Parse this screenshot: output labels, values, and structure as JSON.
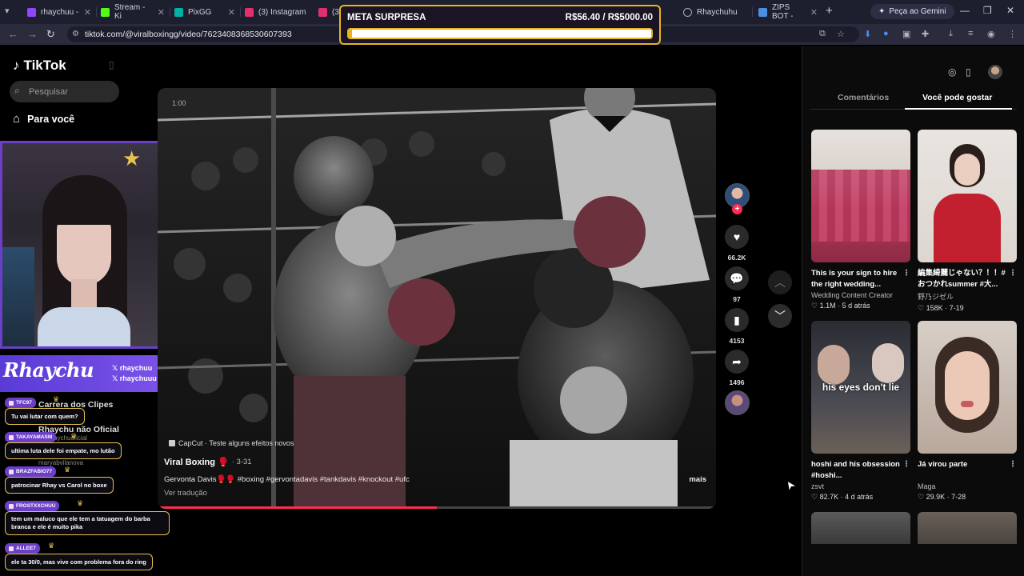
{
  "browser": {
    "tabs": [
      {
        "label": "rhaychuu - ",
        "fav_color": "#9147ff",
        "active": false
      },
      {
        "label": "Stream - Ki",
        "fav_color": "#53fc18",
        "active": false
      },
      {
        "label": "PixGG",
        "fav_color": "#00b3a6",
        "active": false
      },
      {
        "label": "(3) Instagram",
        "fav_color": "#e1306c",
        "active": false
      },
      {
        "label": "(3)",
        "fav_color": "#e1306c",
        "active": false
      },
      {
        "label": "Rhaychuhu",
        "fav_color": "#aaaaaa",
        "active": false
      },
      {
        "label": "ZIPS BOT - ",
        "fav_color": "#4a90e2",
        "active": false
      }
    ],
    "gemini_label": "Peça ao Gemini",
    "url": "tiktok.com/@viralboxingg/video/7623408368530607393"
  },
  "goal": {
    "title": "META SURPRESA",
    "amount": "R$56.40 / R$5000.00",
    "progress": 0.011,
    "accent": "#e6b520"
  },
  "tiktok": {
    "brand": "TikTok",
    "search_placeholder": "Pesquisar",
    "nav_for_you": "Para você",
    "ghost_items": [
      "Carrera dos Clipes",
      "Rhaychu não Oficial",
      "rhaychuoficial",
      "maryabvilanova"
    ]
  },
  "stream_brand": {
    "name": "Rhaychu",
    "handles": [
      "rhaychuu",
      "rhaychuuu"
    ],
    "accent": "#6b3fc8"
  },
  "chat": [
    {
      "user": "TFC97",
      "message": "Tu vai lutar com quem?"
    },
    {
      "user": "TAKAYAMASM",
      "message": "ultima luta dele foi empate, mo lutão"
    },
    {
      "user": "BRAZFABIO77",
      "message": "patrocinar Rhay vs Carol no boxe"
    },
    {
      "user": "FROSTXXCHUU",
      "message": "tem um maluco que ele tem a tatuagem do barba branca e ele é muito pika"
    },
    {
      "user": "ALLEE7",
      "message": "ele ta 30/0, mas vive com problema fora do ring"
    }
  ],
  "video": {
    "timestamp": "1:00",
    "capcut": "CapCut · Teste alguns efeitos novos",
    "author": "Viral Boxing 🥊",
    "date": "· 3-31",
    "description": "Gervonta Davis🥊🥊 #boxing #gervontadavis #tankdavis #knockout #ufc",
    "more": "mais",
    "translate": "Ver tradução",
    "progress": 0.5,
    "likes": "66.2K",
    "comments": "97",
    "saves": "4153",
    "shares": "1496"
  },
  "right_panel": {
    "tab_comments": "Comentários",
    "tab_suggested": "Você pode gostar",
    "cards": [
      {
        "title": "This is your sign to hire the right wedding...",
        "author": "Wedding Content Creator",
        "meta": "♡ 1.1M · 5 d atrás",
        "thumb_caption": ""
      },
      {
        "title": "編集綺麗じゃない？！！#おつかれsummer #大...",
        "author": "野乃ジゼル",
        "meta": "♡ 158K · 7-19",
        "thumb_caption": ""
      },
      {
        "title": "hoshi and his obsession #hoshi...",
        "author": "zsvt",
        "meta": "♡ 82.7K · 4 d atrás",
        "thumb_caption": "his eyes don't lie"
      },
      {
        "title": "Já virou parte",
        "author": "Maga",
        "meta": "♡ 29.9K · 7-28",
        "thumb_caption": ""
      }
    ]
  }
}
